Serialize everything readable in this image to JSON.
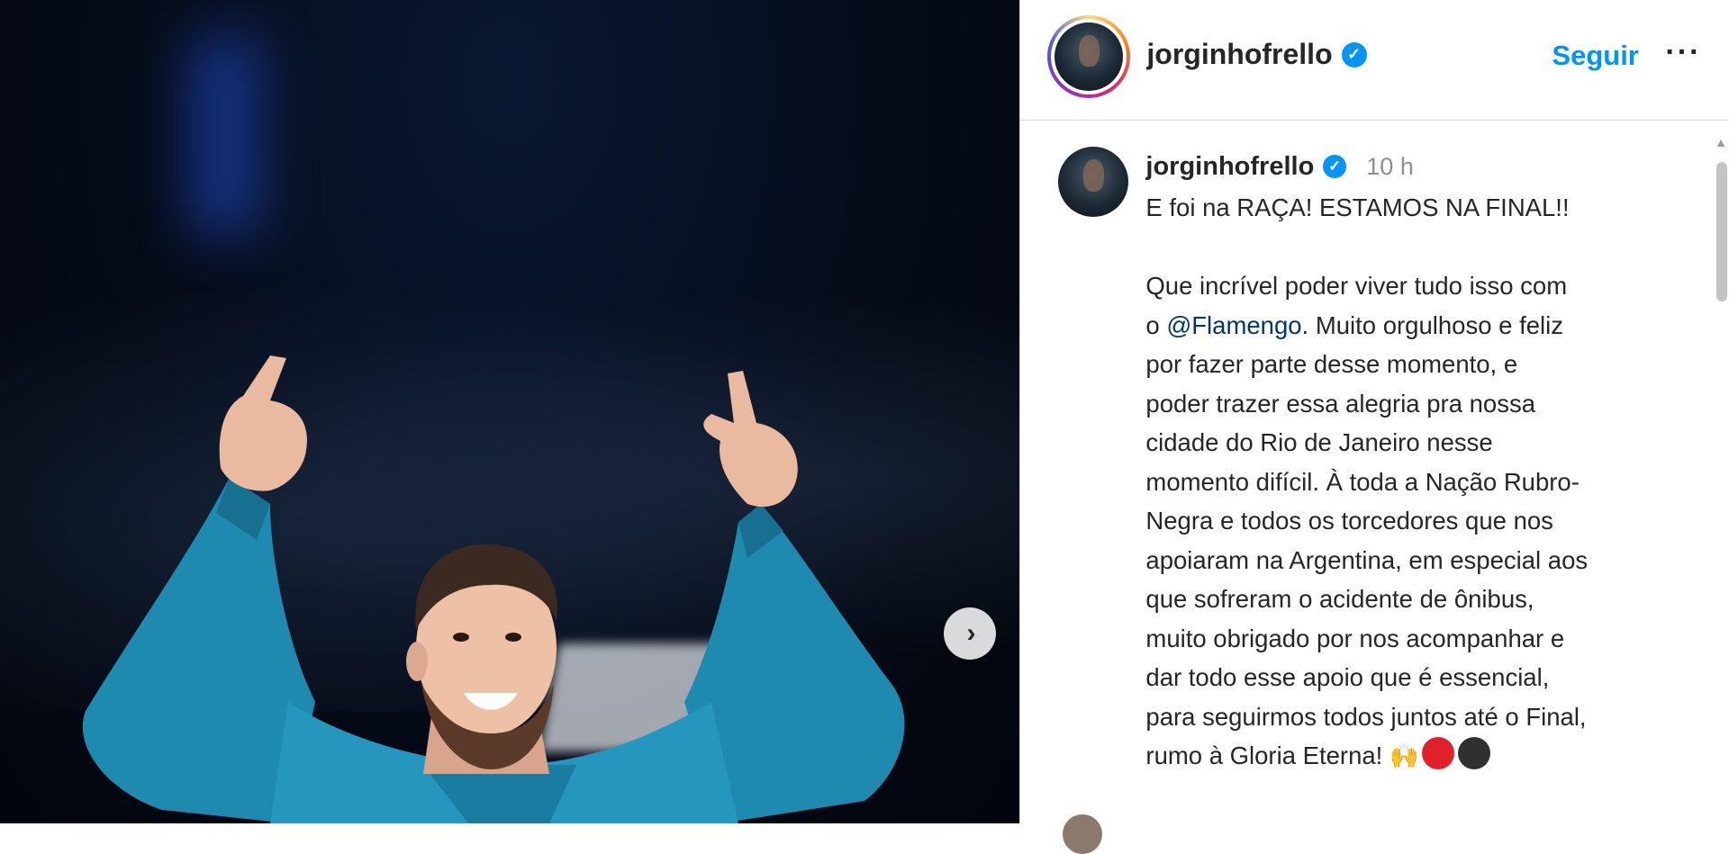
{
  "media": {
    "next_icon": "chevron-right-icon",
    "next_glyph": "›"
  },
  "header": {
    "username": "jorginhofrello",
    "verified_glyph": "✓",
    "follow_label": "Seguir",
    "more_label": "···"
  },
  "post": {
    "username": "jorginhofrello",
    "verified_glyph": "✓",
    "time": "10 h",
    "caption_lines": [
      "E foi na RAÇA! ESTAMOS NA FINAL!!",
      "",
      "Que incrível poder viver tudo isso com"
    ],
    "caption_mention_prefix": "o ",
    "caption_mention": "@Flamengo",
    "caption_mention_suffix": ". Muito orgulhoso e feliz",
    "caption_rest": [
      "por fazer parte desse momento, e",
      "poder trazer essa alegria pra nossa",
      "cidade do Rio de Janeiro nesse",
      "momento difícil. À toda a Nação Rubro-",
      "Negra e todos os torcedores que nos",
      "apoiaram na Argentina, em especial aos",
      "que sofreram o acidente de ônibus,",
      "muito obrigado por nos acompanhar e",
      "dar todo esse apoio que é essencial,",
      "para seguirmos todos juntos até o Final,"
    ],
    "caption_last": "rumo à Gloria Eterna! ",
    "emoji_hands": "🙌",
    "dot_colors": [
      "#e0202a",
      "#303030"
    ]
  },
  "scrollbar": {
    "up_glyph": "▲"
  }
}
